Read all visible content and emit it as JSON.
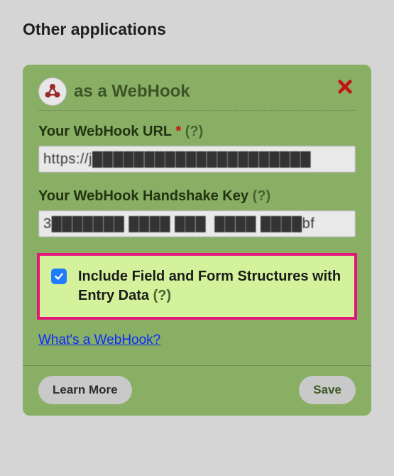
{
  "page": {
    "title": "Other applications"
  },
  "card": {
    "title": "as a WebHook",
    "close_icon": "close",
    "webhook_icon": "webhook",
    "url": {
      "label": "Your WebHook URL",
      "required_mark": "*",
      "help": "(?)",
      "value": "https://j█████████████████████"
    },
    "key": {
      "label": "Your WebHook Handshake Key",
      "help": "(?)",
      "value": "3███████ ████ ███  ████ ████bf"
    },
    "include_structures": {
      "checked": true,
      "label": "Include Field and Form Structures with Entry Data",
      "help": "(?)"
    },
    "link": {
      "text": "What's a WebHook?"
    },
    "footer": {
      "learn_more": "Learn More",
      "save": "Save"
    }
  }
}
